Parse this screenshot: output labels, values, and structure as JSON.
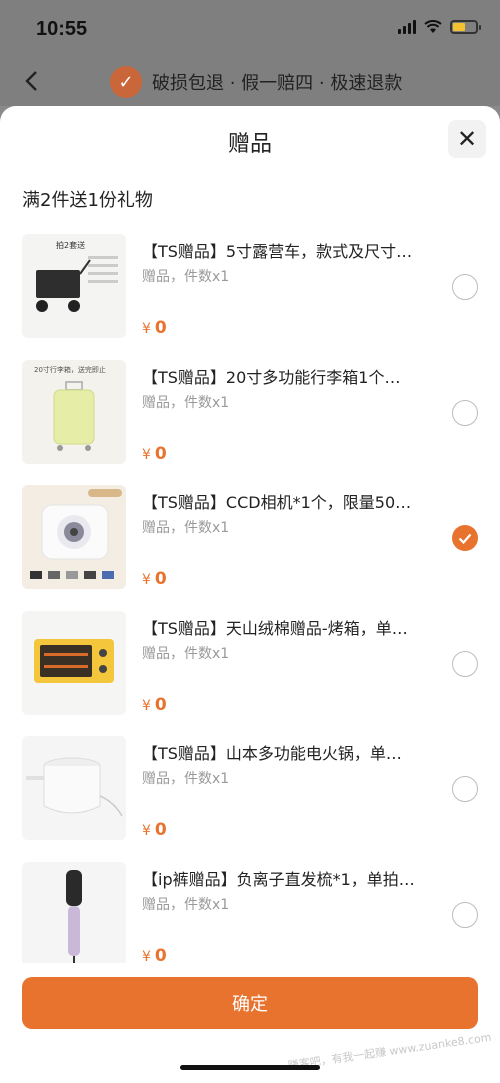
{
  "status_bar": {
    "time": "10:55"
  },
  "header": {
    "guarantee_text": "破损包退 · 假一赔四 · 极速退款"
  },
  "sheet": {
    "title": "赠品",
    "close_label": "✕",
    "promo": "满2件送1份礼物",
    "items": [
      {
        "title": "【TS赠品】5寸露营车，款式及尺寸…",
        "sub": "赠品，件数x1",
        "currency": "¥",
        "price": "0",
        "selected": false,
        "thumb_text": "拍2套送"
      },
      {
        "title": "【TS赠品】20寸多功能行李箱1个…",
        "sub": "赠品，件数x1",
        "currency": "¥",
        "price": "0",
        "selected": false,
        "thumb_text": "20寸行李箱，送完即止"
      },
      {
        "title": "【TS赠品】CCD相机*1个，限量50…",
        "sub": "赠品，件数x1",
        "currency": "¥",
        "price": "0",
        "selected": true,
        "thumb_text": ""
      },
      {
        "title": "【TS赠品】天山绒棉赠品-烤箱，单…",
        "sub": "赠品，件数x1",
        "currency": "¥",
        "price": "0",
        "selected": false,
        "thumb_text": ""
      },
      {
        "title": "【TS赠品】山本多功能电火锅，单…",
        "sub": "赠品，件数x1",
        "currency": "¥",
        "price": "0",
        "selected": false,
        "thumb_text": ""
      },
      {
        "title": "【ip裤赠品】负离子直发梳*1，单拍…",
        "sub": "赠品，件数x1",
        "currency": "¥",
        "price": "0",
        "selected": false,
        "thumb_text": ""
      }
    ],
    "confirm_label": "确定"
  },
  "watermark": "赚客吧，有我一起赚 www.zuanke8.com",
  "colors": {
    "accent": "#e8732f",
    "overlay": "#7f7f7f"
  }
}
